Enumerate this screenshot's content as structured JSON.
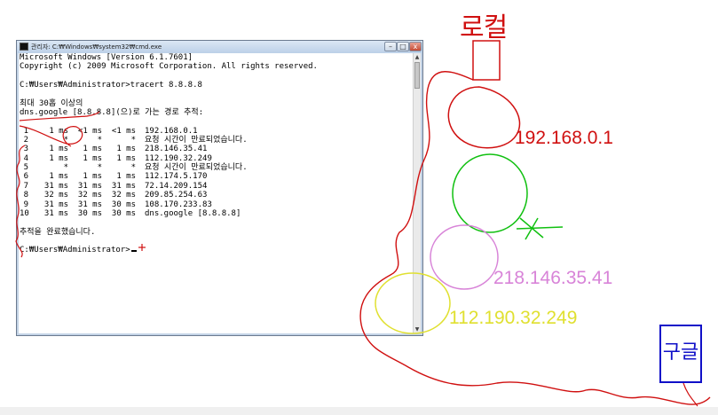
{
  "cmd_window": {
    "title": "관리자: C:₩Windows₩system32₩cmd.exe",
    "minimize_glyph": "–",
    "maximize_glyph": "□",
    "close_glyph": "x",
    "header_lines": [
      "Microsoft Windows [Version 6.1.7601]",
      "Copyright (c) 2009 Microsoft Corporation. All rights reserved."
    ],
    "prompt_command": "C:₩Users₩Administrator>tracert 8.8.8.8",
    "tracing_lines": [
      "최대 30홉 이상의",
      "dns.google [8.8.8.8](으)로 가는 경로 추적:"
    ],
    "hops": [
      {
        "hop": "1",
        "t1": "1 ms",
        "t2": "<1 ms",
        "t3": "<1 ms",
        "host": "192.168.0.1"
      },
      {
        "hop": "2",
        "t1": "*",
        "t2": "*",
        "t3": "*",
        "host": "요청 시간이 만료되었습니다."
      },
      {
        "hop": "3",
        "t1": "1 ms",
        "t2": "1 ms",
        "t3": "1 ms",
        "host": "218.146.35.41"
      },
      {
        "hop": "4",
        "t1": "1 ms",
        "t2": "1 ms",
        "t3": "1 ms",
        "host": "112.190.32.249"
      },
      {
        "hop": "5",
        "t1": "*",
        "t2": "*",
        "t3": "*",
        "host": "요청 시간이 만료되었습니다."
      },
      {
        "hop": "6",
        "t1": "1 ms",
        "t2": "1 ms",
        "t3": "1 ms",
        "host": "112.174.5.170"
      },
      {
        "hop": "7",
        "t1": "31 ms",
        "t2": "31 ms",
        "t3": "31 ms",
        "host": "72.14.209.154"
      },
      {
        "hop": "8",
        "t1": "32 ms",
        "t2": "32 ms",
        "t3": "32 ms",
        "host": "209.85.254.63"
      },
      {
        "hop": "9",
        "t1": "31 ms",
        "t2": "31 ms",
        "t3": "30 ms",
        "host": "108.170.233.83"
      },
      {
        "hop": "10",
        "t1": "31 ms",
        "t2": "30 ms",
        "t3": "30 ms",
        "host": "dns.google [8.8.8.8]"
      }
    ],
    "complete_line": "추적을 완료했습니다.",
    "final_prompt": "C:₩Users₩Administrator>"
  },
  "annotations": {
    "router_label": "로컬",
    "hop1_ip": "192.168.0.1",
    "hop3_ip": "218.146.35.41",
    "hop4_ip": "112.190.32.249",
    "google_label": "구글",
    "colors": {
      "red": "#d01010",
      "green": "#10c010",
      "pink": "#d884d8",
      "yellow": "#e0e030",
      "blue": "#1010c8"
    }
  }
}
